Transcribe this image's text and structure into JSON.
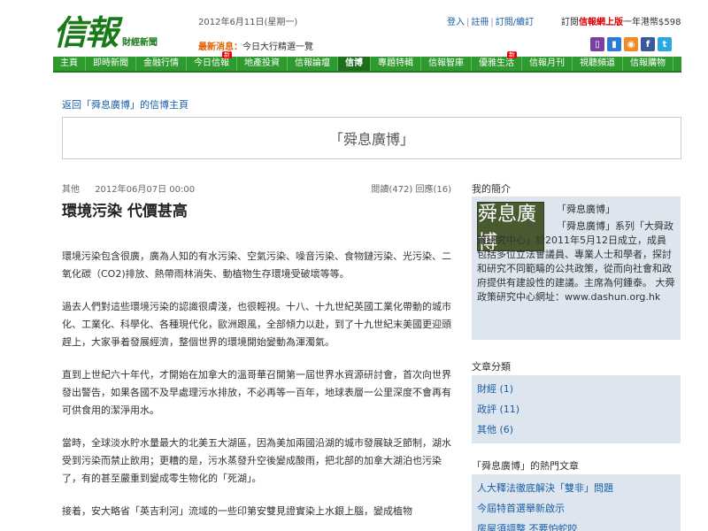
{
  "header": {
    "logo": "信報",
    "logo_sub": "財經新聞",
    "date": "2012年6月11日(星期一)",
    "news_label": "最新消息：",
    "news_text": "今日大行精選一覽",
    "login": "登入",
    "register": "註冊",
    "subscribe": "訂閱/續訂",
    "promo_prefix": "訂閱",
    "promo_highlight": "信報網上版",
    "promo_suffix": "一年港幣$598",
    "icons": [
      {
        "name": "mobile-icon",
        "glyph": "▯",
        "color": "#7b3fa0"
      },
      {
        "name": "app-icon",
        "glyph": "▮",
        "color": "#2d7bd6"
      },
      {
        "name": "rss-icon",
        "glyph": "◉",
        "color": "#f08a24"
      },
      {
        "name": "facebook-icon",
        "glyph": "f",
        "color": "#3b5998"
      },
      {
        "name": "twitter-icon",
        "glyph": "t",
        "color": "#29a9e1"
      }
    ]
  },
  "nav": {
    "items": [
      "主頁",
      "即時新聞",
      "金融行情",
      "今日信報",
      "地產投資",
      "信報論壇",
      "信博",
      "專題特輯",
      "信報智庫",
      "優雅生活",
      "信報月刊",
      "視聽頻道",
      "信報購物"
    ],
    "new_badge": "新"
  },
  "back_link": "返回「舜息廣博」的信博主頁",
  "blog_title": "「舜息廣博」",
  "article": {
    "category": "其他",
    "datetime": "2012年06月07日 00:00",
    "stats": "閱讀(472) 回應(16)",
    "title": "環境污染 代價甚高",
    "paragraphs": [
      "環境污染包含很廣，廣為人知的有水污染、空氣污染、噪音污染、食物鏈污染、光污染、二氧化碳（CO2)排放、熱帶雨林消失、動植物生存環境受破壞等等。",
      "過去人們對這些環境污染的認識很膚淺，也很輕視。十八、十九世紀英國工業化帶動的城市化、工業化、科學化、各種現代化，歐洲跟風，全部傾力以赴，到了十九世紀末美國更迎頭趕上，大家爭着發展經濟，整個世界的環境開始變動為渾濁氣。",
      "直到上世紀六十年代，才開始在加拿大的溫哥華召開第一屆世界水資源研討會，首次向世界發出警告，如果各國不及早處理污水排放，不必再等一百年，地球表層一公里深度不會再有可供食用的潔淨用水。",
      "當時，全球淡水貯水量最大的北美五大湖區，因為美加兩國沿湖的城市發展缺乏節制，湖水受到污染而禁止飲用；更糟的是，污水蒸發升空後變成酸雨，把北部的加拿大湖泊也污染了，有的甚至嚴重到變成零生物化的「死湖」。",
      "接着，安大略省「英吉利河」流域的一些印第安雙見證實染上水銀上腦，變成植物"
    ]
  },
  "sidebar": {
    "profile_heading": "我的簡介",
    "profile_logo": "舜息廣博",
    "profile_name": "「舜息廣博」",
    "profile_text": "「舜息廣博」系列「大舜政策研究中心」於2011年5月12日成立，成員包括多位立法會議員、專業人士和學者，探討和研究不同範疇的公共政策，從而向社會和政府提供有建設性的建議。主席為何鍾泰。 大舜政策研究中心網址：www.dashun.org.hk",
    "category_heading": "文章分類",
    "categories": [
      "財經 (1)",
      "政評 (11)",
      "其他 (6)"
    ],
    "hot_heading": "「舜息廣博」的熱門文章",
    "hot_articles": [
      "人大釋法徹底解決「雙非」問題",
      "今屆特首選舉新啟示",
      "房屋須調整 不要怕蛇咬"
    ]
  }
}
